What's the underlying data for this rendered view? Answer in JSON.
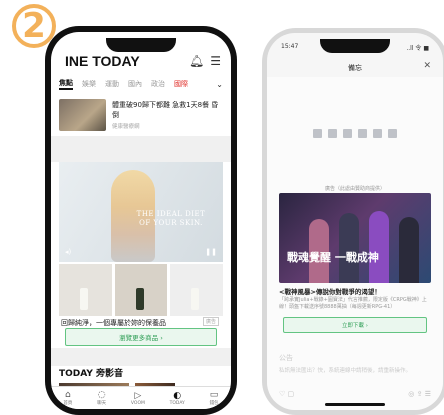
{
  "badge": {
    "number": "2",
    "color": "#f3b15a"
  },
  "phone1": {
    "logo": "INE TODAY",
    "header_icons": [
      "bell-icon",
      "menu-icon"
    ],
    "tabs": [
      {
        "label": "焦點"
      },
      {
        "label": "娛樂"
      },
      {
        "label": "運動"
      },
      {
        "label": "國內"
      },
      {
        "label": "政治"
      },
      {
        "label": "國際"
      }
    ],
    "article": {
      "title": "體重破90歸下都難 急救1天8餐 昏倒",
      "source": "健康醫療網"
    },
    "ad": {
      "headline": "THE IDEAL DIET OF YOUR SKIN."
    },
    "product_title": "回歸純淨，一個專屬於妳的保養品",
    "product_tag": "廣告",
    "cta": "瀏覽更多商品 ›",
    "video_section": "TODAY 旁影音",
    "bottom_nav": [
      {
        "label": "首頁",
        "icon": "home-icon"
      },
      {
        "label": "聊天",
        "icon": "chat-icon"
      },
      {
        "label": "VOOM",
        "icon": "play-icon"
      },
      {
        "label": "TODAY",
        "icon": "today-icon"
      },
      {
        "label": "錢包",
        "icon": "wallet-icon"
      }
    ],
    "accent_color": "#2e9e55"
  },
  "phone2": {
    "status": {
      "time": "15:47",
      "signal": "..ll 令 ■"
    },
    "header": "備忘",
    "sponsor": "廣告（此處由贊助商提供）",
    "banner_title": "戰魂覺醒 一戰成神",
    "desc_title": "<戰神風暴>傳說你對戰爭的渴望！",
    "desc": "「跨承實Julia+戰錄+圓寶法」代言推薦，限定版《CRPG戰神》上線！頭盔下載送序號8888萬抽（每週更新RPG-41）",
    "download": "立即下載 ›",
    "comments_label": "公告",
    "comments_text": "私訊無法匯出？快，系統連線中請稍後，請重新操作。",
    "bottom_icons": [
      "comment-icon",
      "like-icon",
      "share-icon"
    ]
  }
}
